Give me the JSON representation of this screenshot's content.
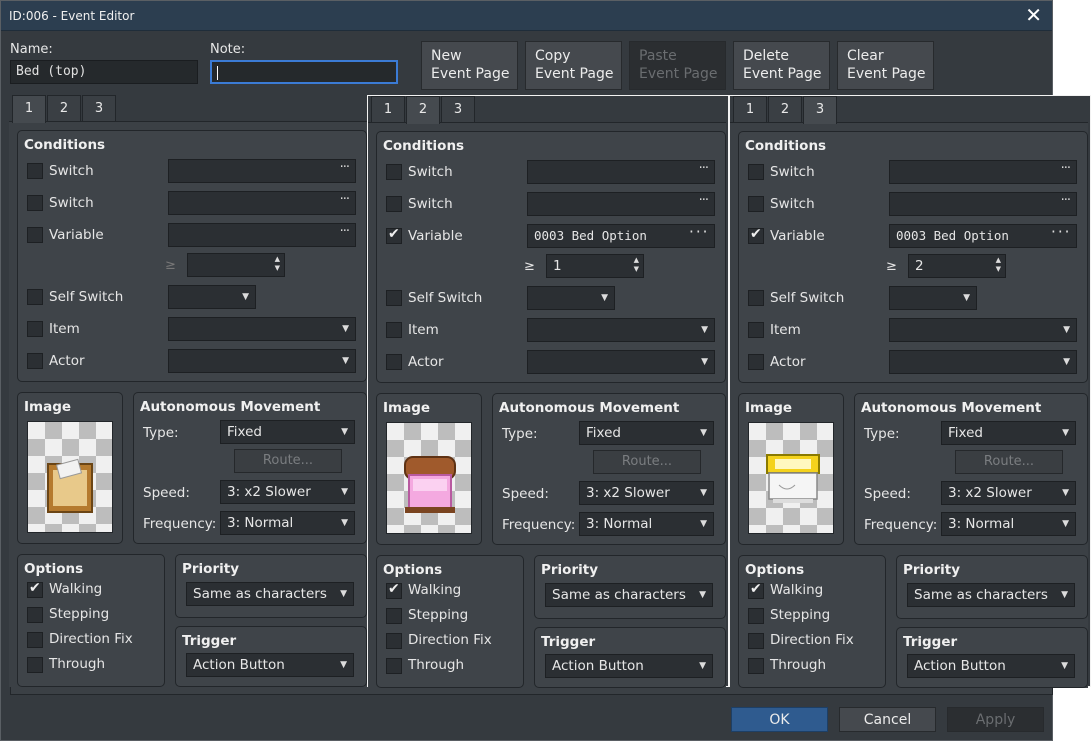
{
  "window": {
    "title": "ID:006 - Event Editor",
    "close": "✕"
  },
  "name": {
    "label": "Name:",
    "value": "Bed (top)"
  },
  "note": {
    "label": "Note:",
    "value": ""
  },
  "toolbar": {
    "new": "New\nEvent Page",
    "copy": "Copy\nEvent Page",
    "paste": "Paste\nEvent Page",
    "delete": "Delete\nEvent Page",
    "clear": "Clear\nEvent Page"
  },
  "tabs": [
    "1",
    "2",
    "3"
  ],
  "labels": {
    "conditions": "Conditions",
    "switch": "Switch",
    "variable": "Variable",
    "self_switch": "Self Switch",
    "item": "Item",
    "actor": "Actor",
    "image": "Image",
    "autonomous": "Autonomous Movement",
    "type": "Type:",
    "route": "Route...",
    "speed": "Speed:",
    "frequency": "Frequency:",
    "options": "Options",
    "walking": "Walking",
    "stepping": "Stepping",
    "direction_fix": "Direction Fix",
    "through": "Through",
    "priority": "Priority",
    "trigger": "Trigger",
    "gte": "≥"
  },
  "pages": [
    {
      "variable_checked": false,
      "variable_value": "",
      "variable_num": "",
      "type": "Fixed",
      "speed": "3: x2 Slower",
      "frequency": "3: Normal",
      "walking": true,
      "priority": "Same as characters",
      "trigger": "Action Button",
      "image": "box-sprite"
    },
    {
      "variable_checked": true,
      "variable_value": "0003 Bed Option",
      "variable_num": "1",
      "type": "Fixed",
      "speed": "3: x2 Slower",
      "frequency": "3: Normal",
      "walking": true,
      "priority": "Same as characters",
      "trigger": "Action Button",
      "image": "pink-bed-sprite"
    },
    {
      "variable_checked": true,
      "variable_value": "0003 Bed Option",
      "variable_num": "2",
      "type": "Fixed",
      "speed": "3: x2 Slower",
      "frequency": "3: Normal",
      "walking": true,
      "priority": "Same as characters",
      "trigger": "Action Button",
      "image": "yellow-bed-sprite"
    }
  ],
  "footer": {
    "ok": "OK",
    "cancel": "Cancel",
    "apply": "Apply"
  },
  "colors": {
    "accent": "#2f5b8f",
    "titlebar": "#2c3e50",
    "background": "#353a3f"
  }
}
